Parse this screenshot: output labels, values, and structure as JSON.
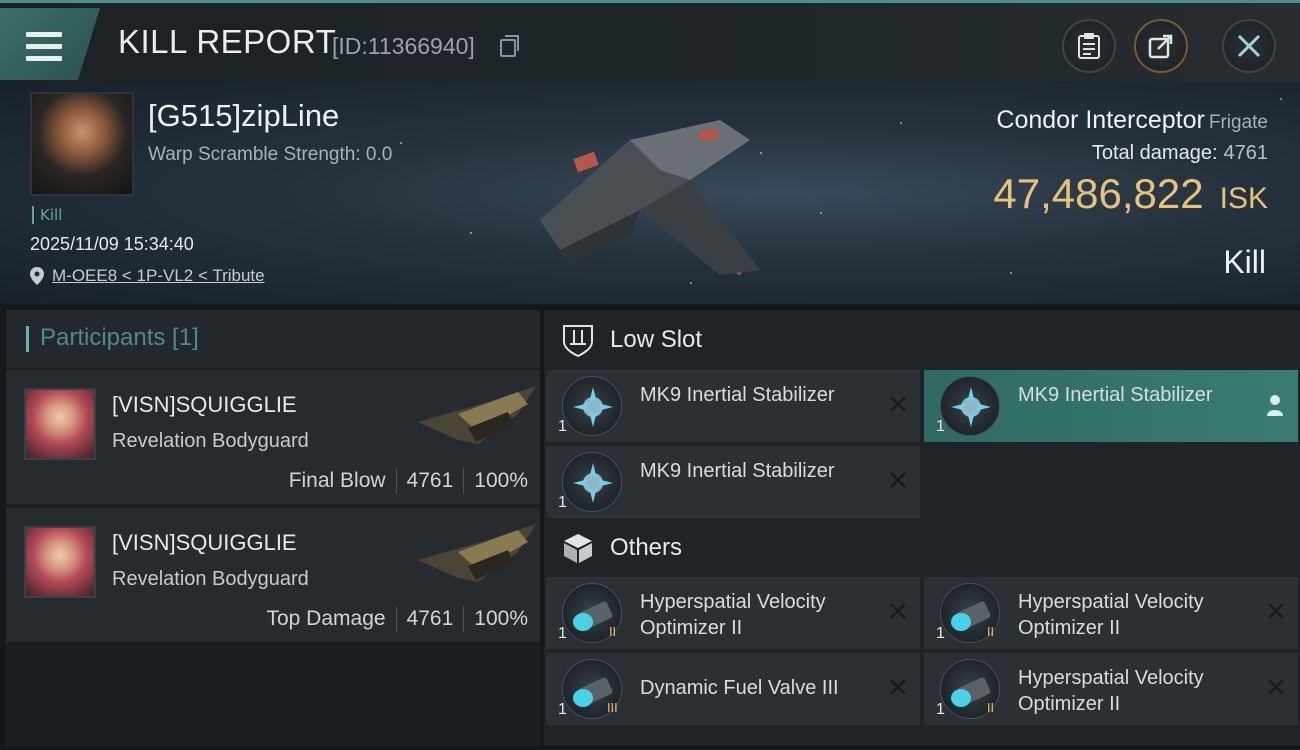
{
  "header": {
    "title": "KILL REPORT",
    "id_text": "[ID:11366940]"
  },
  "victim": {
    "name": "[G515]zipLine",
    "warp_scramble": "Warp Scramble Strength: 0.0",
    "tag": "Kill",
    "datetime": "2025/11/09 15:34:40",
    "location": "M-OEE8 < 1P-VL2 < Tribute",
    "ship": "Condor Interceptor",
    "ship_class": "Frigate",
    "total_damage_label": "Total damage:",
    "total_damage": "4761",
    "isk_value": "47,486,822",
    "isk_unit": "ISK",
    "result": "Kill"
  },
  "participants": {
    "title": "Participants [1]",
    "rows": [
      {
        "name": "[VISN]SQUIGGLIE",
        "ship": "Revelation Bodyguard",
        "role": "Final Blow",
        "damage": "4761",
        "percent": "100%"
      },
      {
        "name": "[VISN]SQUIGGLIE",
        "ship": "Revelation Bodyguard",
        "role": "Top Damage",
        "damage": "4761",
        "percent": "100%"
      }
    ]
  },
  "low_slot": {
    "title": "Low Slot",
    "modules": [
      {
        "qty": "1",
        "name": "MK9 Inertial Stabilizer",
        "status": "destroyed"
      },
      {
        "qty": "1",
        "name": "MK9 Inertial Stabilizer",
        "status": "dropped"
      },
      {
        "qty": "1",
        "name": "MK9 Inertial Stabilizer",
        "status": "destroyed"
      }
    ]
  },
  "others": {
    "title": "Others",
    "modules": [
      {
        "qty": "1",
        "name": "Hyperspatial Velocity Optimizer II",
        "status": "destroyed"
      },
      {
        "qty": "1",
        "name": "Hyperspatial Velocity Optimizer II",
        "status": "destroyed"
      },
      {
        "qty": "1",
        "name": "Dynamic Fuel Valve III",
        "status": "destroyed"
      },
      {
        "qty": "1",
        "name": "Hyperspatial Velocity Optimizer II",
        "status": "destroyed"
      }
    ]
  },
  "colors": {
    "accent": "#4b8f86",
    "isk": "#e7c27a",
    "highlight": "#3a7d73"
  },
  "icons": [
    "menu-icon",
    "copy-icon",
    "clipboard-icon",
    "share-icon",
    "close-icon",
    "location-pin-icon",
    "shield-slot-icon",
    "cube-icon",
    "x-icon",
    "person-icon"
  ]
}
